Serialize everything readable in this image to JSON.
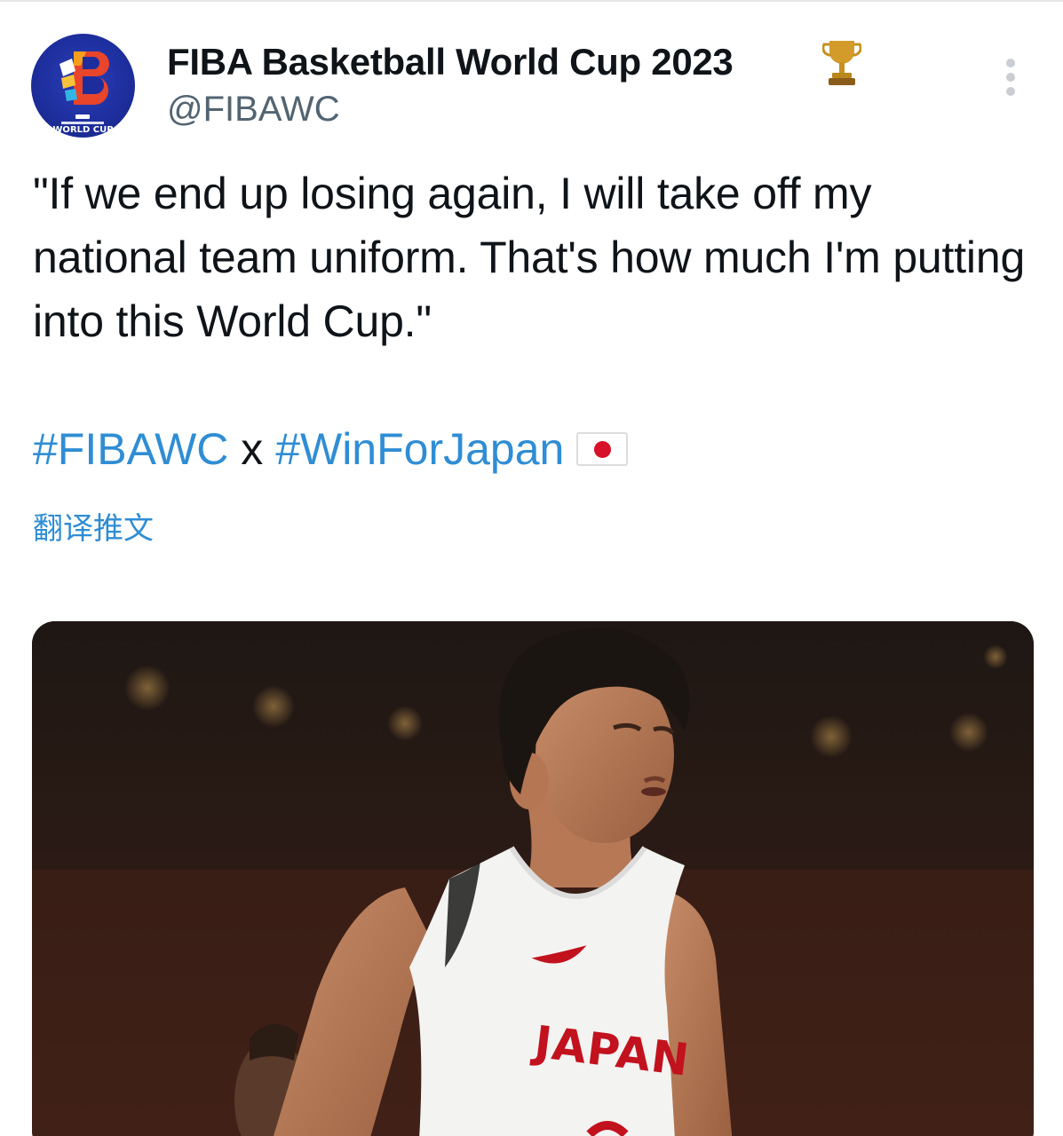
{
  "tweet": {
    "author": {
      "display_name": "FIBA Basketball World Cup 2023",
      "handle": "@FIBAWC",
      "avatar_icon": "fiba-world-cup-logo",
      "avatar_text": "WORLD CUP",
      "badge_icon": "trophy-icon"
    },
    "text": "\"If we end up losing again, I will take off my national team uniform. That's how much I'm putting into this World Cup.\"",
    "hashtags": {
      "first": "#FIBAWC",
      "separator": " x ",
      "second": "#WinForJapan",
      "flag_icon": "japan-flag-icon"
    },
    "translate_label": "翻译推文",
    "media": {
      "jersey_text": "JAPAN"
    }
  },
  "colors": {
    "text": "#0f1419",
    "secondary": "#536471",
    "link": "#2f8dd4",
    "avatar_bg": "#1d2e9c",
    "jersey_red": "#c2121e"
  }
}
